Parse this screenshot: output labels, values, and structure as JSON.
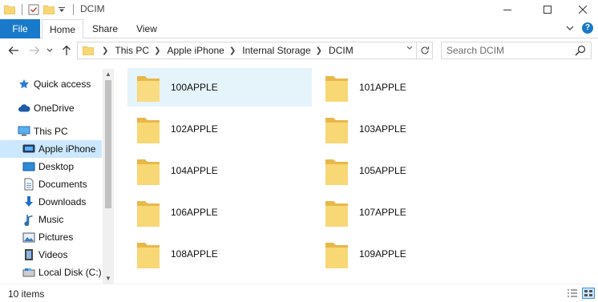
{
  "window": {
    "title": "DCIM"
  },
  "ribbon": {
    "tabs": [
      "File",
      "Home",
      "Share",
      "View"
    ]
  },
  "address": {
    "crumbs": [
      "This PC",
      "Apple iPhone",
      "Internal Storage",
      "DCIM"
    ]
  },
  "search": {
    "placeholder": "Search DCIM"
  },
  "nav": {
    "items": [
      {
        "label": "Quick access",
        "icon": "star-icon"
      },
      {
        "label": "OneDrive",
        "icon": "cloud-icon"
      },
      {
        "label": "This PC",
        "icon": "computer-icon"
      },
      {
        "label": "Apple iPhone",
        "icon": "iphone-icon",
        "selected": true
      },
      {
        "label": "Desktop",
        "icon": "desktop-icon"
      },
      {
        "label": "Documents",
        "icon": "documents-icon"
      },
      {
        "label": "Downloads",
        "icon": "downloads-icon"
      },
      {
        "label": "Music",
        "icon": "music-icon"
      },
      {
        "label": "Pictures",
        "icon": "pictures-icon"
      },
      {
        "label": "Videos",
        "icon": "videos-icon"
      },
      {
        "label": "Local Disk (C:)",
        "icon": "disk-icon"
      }
    ]
  },
  "folders": [
    {
      "name": "100APPLE",
      "selected": true
    },
    {
      "name": "101APPLE"
    },
    {
      "name": "102APPLE"
    },
    {
      "name": "103APPLE"
    },
    {
      "name": "104APPLE"
    },
    {
      "name": "105APPLE"
    },
    {
      "name": "106APPLE"
    },
    {
      "name": "107APPLE"
    },
    {
      "name": "108APPLE"
    },
    {
      "name": "109APPLE"
    }
  ],
  "status": {
    "item_count": "10 items"
  },
  "colors": {
    "accent": "#1979ca",
    "selection": "#cce8ff",
    "hover": "#e5f3fb",
    "folder": "#f8d775"
  }
}
